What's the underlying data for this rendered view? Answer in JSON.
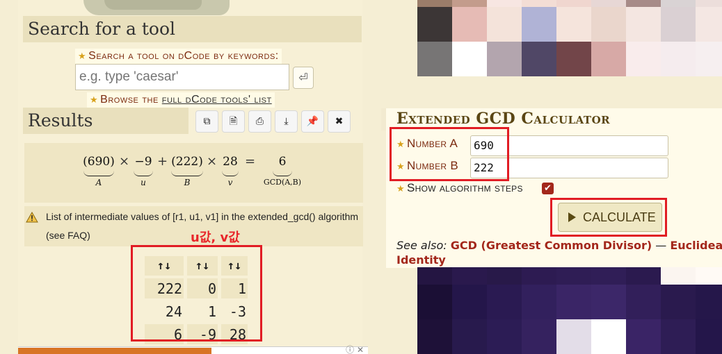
{
  "search": {
    "title": "Search for a tool",
    "label": "Search a tool on dCode by keywords:",
    "placeholder": "e.g. type 'caesar'",
    "go_icon": "enter-icon",
    "browse_prefix": "Browse the ",
    "browse_link": "full dCode tools' list"
  },
  "results": {
    "title": "Results",
    "toolbar": [
      {
        "name": "copy-icon",
        "glyph": "⧉"
      },
      {
        "name": "archive-icon",
        "glyph": "🗎"
      },
      {
        "name": "print-icon",
        "glyph": "⎙"
      },
      {
        "name": "download-icon",
        "glyph": "⤓"
      },
      {
        "name": "pin-icon",
        "glyph": "📌"
      },
      {
        "name": "close-icon",
        "glyph": "✖"
      }
    ],
    "formula": {
      "a": "(690)",
      "a_label": "A",
      "u": "−9",
      "u_label": "u",
      "b": "(222)",
      "b_label": "B",
      "v": "28",
      "v_label": "v",
      "g": "6",
      "g_label": "GCD(A,B)",
      "times": "×",
      "plus": "+",
      "equals": "="
    },
    "warning": "List of intermediate values of [r1, u1, v1] in the extended_gcd() algorithm (see FAQ)",
    "annotation": "u값, v값",
    "table": {
      "headers": [
        "↑↓",
        "↑↓",
        "↑↓"
      ],
      "rows": [
        [
          "222",
          "0",
          "1"
        ],
        [
          "24",
          "1",
          "-3"
        ],
        [
          "6",
          "-9",
          "28"
        ]
      ]
    }
  },
  "calculator": {
    "title": "Extended GCD Calculator",
    "number_a_label": "Number A",
    "number_a_value": "690",
    "number_b_label": "Number B",
    "number_b_value": "222",
    "steps_label": "Show algorithm steps",
    "steps_checked": true,
    "button_label": "CALCULATE",
    "see_also_label": "See also:",
    "see_also_links": [
      "GCD (Greatest Common Divisor)",
      "Euclidean D"
    ],
    "see_also_sep": " — ",
    "see_also_line2": "Identity"
  },
  "colors": {
    "accent_red": "#e11c24",
    "link_red": "#a3271b",
    "panel_bg": "#f7f0d6"
  },
  "mosaic_top": [
    "#9b7d6a",
    "#c39c8c",
    "#f7e6e2",
    "#f3ddd5",
    "#f0d6cf",
    "#e7d7d5",
    "#a78b88",
    "#d9d3d4",
    "#ecdedb",
    "#3c3636",
    "#e6bbb5",
    "#f4e3da",
    "#b0b3d6",
    "#f5e4dc",
    "#ead6cc",
    "#f4e6e1",
    "#dad0d3",
    "#f4e7e3",
    "#777575",
    "#ffffff",
    "#b3a5ae",
    "#504766",
    "#724549",
    "#d7a9a6",
    "#f9ecec",
    "#f5ecee",
    "#f6eff0"
  ],
  "mosaic_bot": [
    "#241542",
    "#2a194d",
    "#281949",
    "#2d1b52",
    "#2f1d55",
    "#301e57",
    "#2b1a4f",
    "#fbf5f0",
    "#fffaf5",
    "#1b0f35",
    "#24164a",
    "#2a1a52",
    "#32205d",
    "#3a2566",
    "#3c2769",
    "#321f5a",
    "#2a1a4e",
    "#25174a",
    "#1e1138",
    "#281a4d",
    "#2c1c55",
    "#35225f",
    "#e3dde8",
    "#ffffff",
    "#3a2466",
    "#2e1d55",
    "#24164a"
  ]
}
